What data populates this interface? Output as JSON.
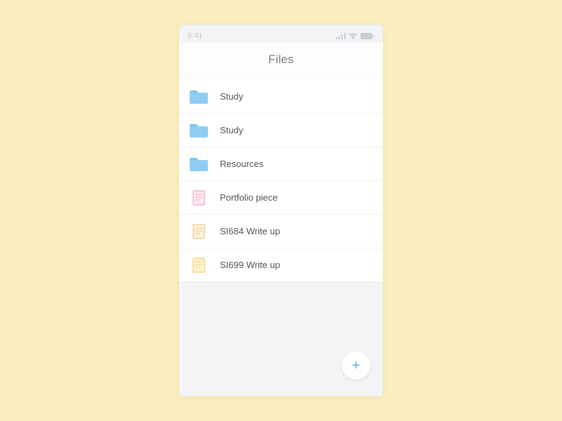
{
  "status": {
    "time": "9:41"
  },
  "header": {
    "title": "Files"
  },
  "items": [
    {
      "type": "folder",
      "label": "Study",
      "color": "#8fcef2"
    },
    {
      "type": "folder",
      "label": "Study",
      "color": "#8fcef2"
    },
    {
      "type": "folder",
      "label": "Resources",
      "color": "#8fcef2"
    },
    {
      "type": "file",
      "label": "Portfolio piece",
      "outline": "#f1a8b8",
      "fill": "#fdecef"
    },
    {
      "type": "file",
      "label": "SI684 Write up",
      "outline": "#f0c982",
      "fill": "#fcf2dc"
    },
    {
      "type": "file",
      "label": "SI699 Write up",
      "outline": "#f1d06a",
      "fill": "#fdf4d4"
    }
  ],
  "fab": {
    "glyph": "+"
  }
}
